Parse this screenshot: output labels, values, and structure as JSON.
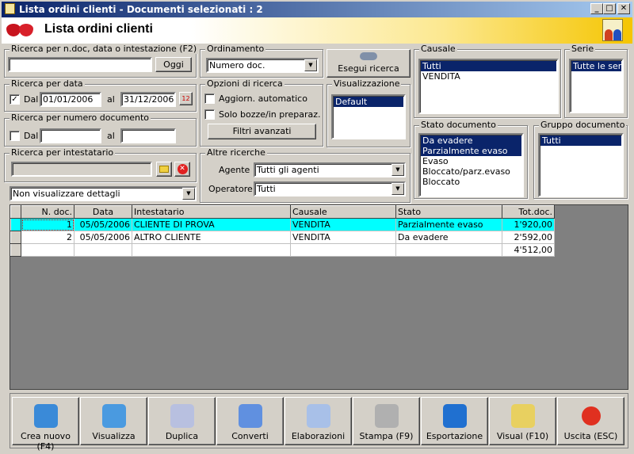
{
  "window": {
    "title": "Lista ordini clienti - Documenti selezionati : 2",
    "min": "_",
    "max": "□",
    "close": "✕"
  },
  "header": {
    "title": "Lista ordini clienti"
  },
  "search_text": {
    "legend": "Ricerca per n.doc, data o intestazione (F2)",
    "value": "",
    "today_button": "Oggi"
  },
  "date_search": {
    "legend": "Ricerca per data",
    "checked": true,
    "from_label": "Dal",
    "from": "01/01/2006",
    "to_label": "al",
    "to": "31/12/2006"
  },
  "number_search": {
    "legend": "Ricerca per numero documento",
    "checked": false,
    "from_label": "Dal",
    "from": "",
    "to_label": "al",
    "to": ""
  },
  "holder_search": {
    "legend": "Ricerca per intestatario",
    "value": ""
  },
  "details_combo": "Non visualizzare dettagli",
  "ordering": {
    "legend": "Ordinamento",
    "value": "Numero doc."
  },
  "execute_button": "Esegui ricerca",
  "options": {
    "legend": "Opzioni di ricerca",
    "auto_update": "Aggiorn. automatico",
    "drafts_only": "Solo bozze/in preparaz.",
    "advanced_filters": "Filtri avanzati"
  },
  "view": {
    "legend": "Visualizzazione",
    "items": [
      "Default"
    ]
  },
  "other": {
    "legend": "Altre ricerche",
    "agent_label": "Agente :",
    "agent": "Tutti gli agenti",
    "operator_label": "Operatore :",
    "operator": "Tutti"
  },
  "causale": {
    "legend": "Causale",
    "items": [
      "Tutti",
      "VENDITA"
    ]
  },
  "serie": {
    "legend": "Serie",
    "items": [
      "Tutte le serie"
    ]
  },
  "stato": {
    "legend": "Stato documento",
    "items": [
      "Da evadere",
      "Parzialmente evaso",
      "Evaso",
      "Bloccato/parz.evaso",
      "Bloccato"
    ]
  },
  "gruppo": {
    "legend": "Gruppo documento",
    "items": [
      "Tutti"
    ]
  },
  "table": {
    "columns": [
      "N. doc.",
      "Data",
      "Intestatario",
      "Causale",
      "Stato",
      "Tot.doc."
    ],
    "rows": [
      [
        "1",
        "05/05/2006",
        "CLIENTE DI PROVA",
        "VENDITA",
        "Parzialmente evaso",
        "1'920,00"
      ],
      [
        "2",
        "05/05/2006",
        "ALTRO CLIENTE",
        "VENDITA",
        "Da evadere",
        "2'592,00"
      ]
    ],
    "total": "4'512,00"
  },
  "buttons": [
    "Crea nuovo (F4)",
    "Visualizza",
    "Duplica",
    "Converti",
    "Elaborazioni",
    "Stampa (F9)",
    "Esportazione",
    "Visual (F10)",
    "Uscita (ESC)"
  ]
}
